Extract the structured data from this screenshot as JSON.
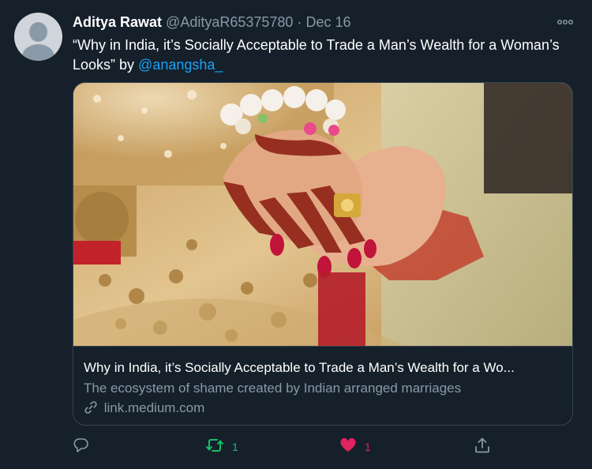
{
  "tweet": {
    "display_name": "Aditya Rawat",
    "handle": "@AdityaR65375780",
    "separator": "·",
    "date": "Dec 16",
    "more_icon": "more-icon",
    "text_before": "“Why in India, it’s Socially Acceptable to Trade a Man’s Wealth for a Woman’s Looks” by ",
    "mention": "@anangsha_"
  },
  "card": {
    "image_icon": "wedding-hands-photo",
    "title": "Why in India, it’s Socially Acceptable to Trade a Man’s Wealth for a Wo...",
    "description": "The ecosystem of shame created by Indian arranged marriages",
    "link_icon": "link-icon",
    "domain": "link.medium.com"
  },
  "actions": {
    "reply_icon": "reply-icon",
    "reply_count": "",
    "retweet_icon": "retweet-icon",
    "retweet_count": "1",
    "like_icon": "heart-icon",
    "like_count": "1",
    "share_icon": "share-icon"
  },
  "colors": {
    "background": "#15202b",
    "accent": "#1da1f2",
    "secondary_text": "#8899a6",
    "retweet": "#17bf63",
    "like": "#e0245e",
    "border": "#38444d"
  }
}
